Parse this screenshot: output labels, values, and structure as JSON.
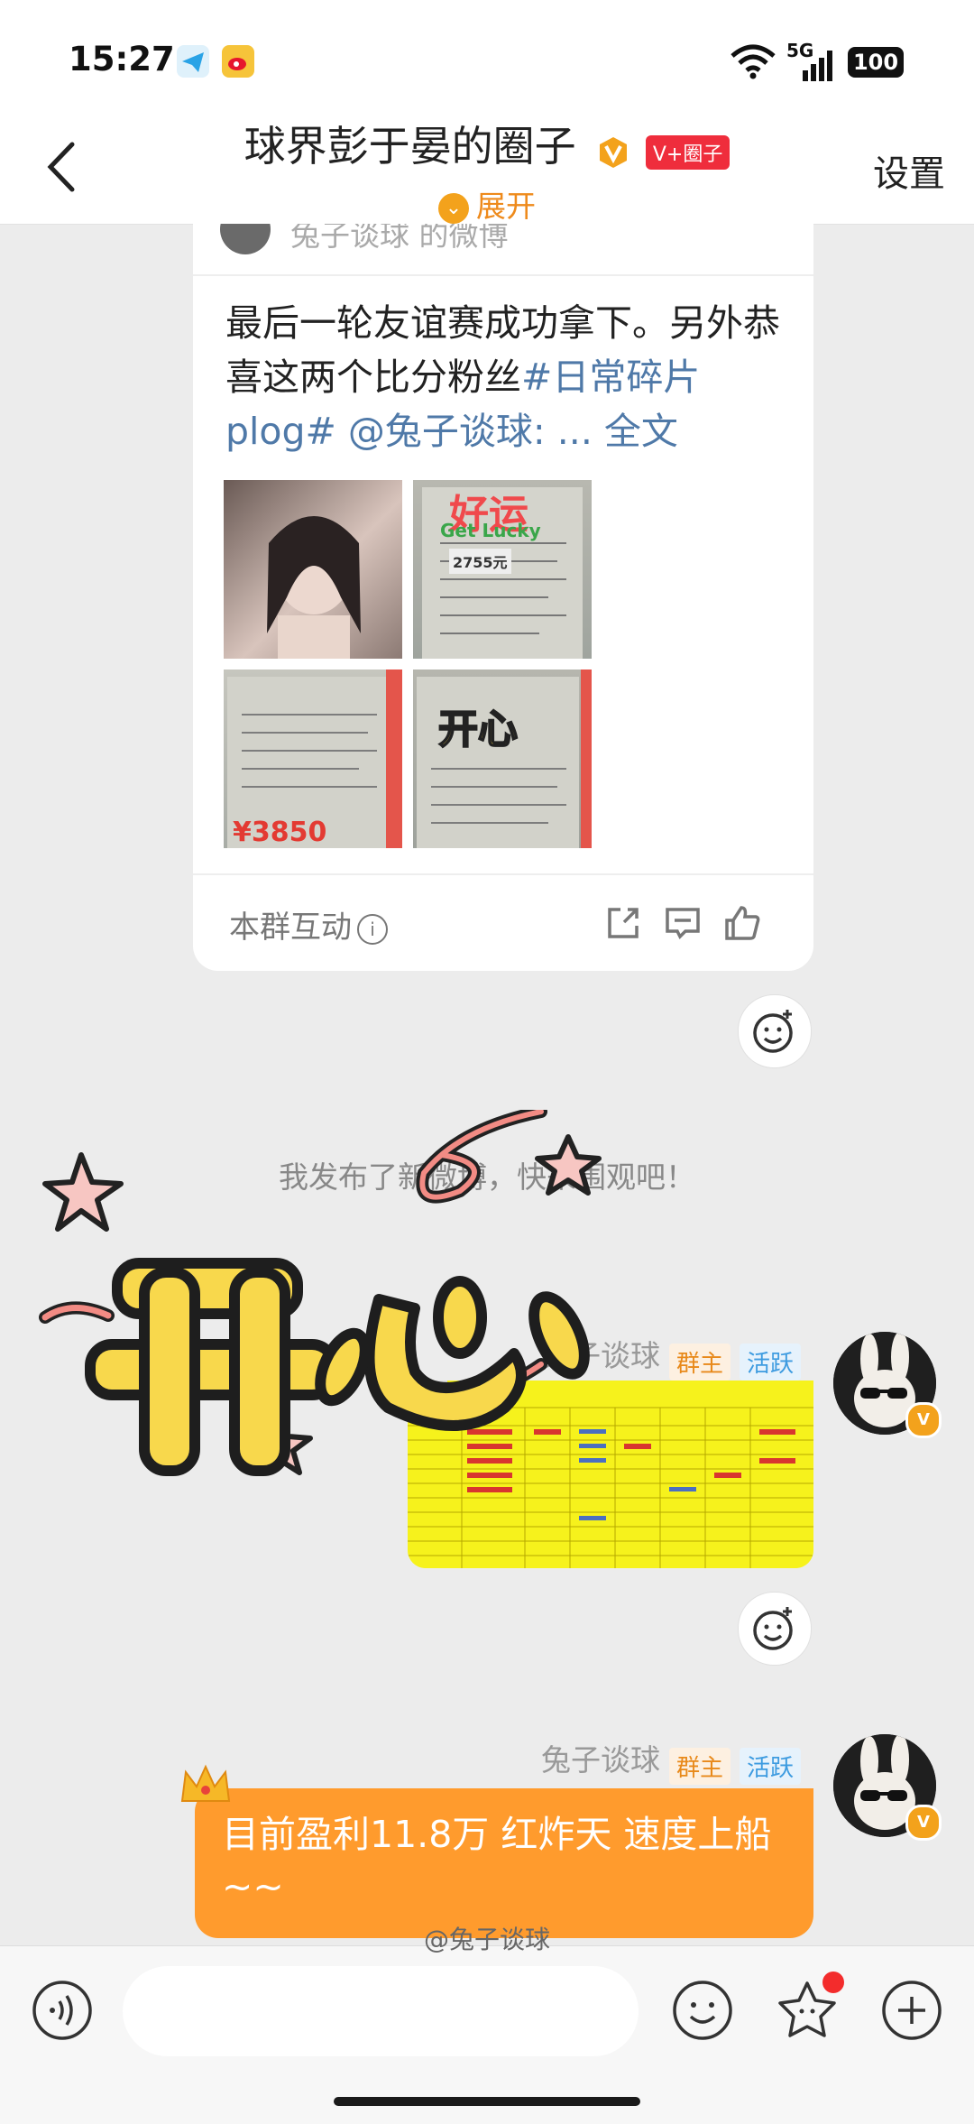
{
  "status_bar": {
    "time": "15:27",
    "network": "5G",
    "battery": "100"
  },
  "header": {
    "back_icon": "chevron-left-icon",
    "title": "球界彭于晏的圈子",
    "badge": "V+圈子",
    "expand_label": "展开",
    "settings_label": "设置"
  },
  "card": {
    "source": "兔子谈球 的微博",
    "text_main": "最后一轮友谊赛成功拿下。另外恭喜这两个比分粉丝",
    "text_hashtag": "#日常碎片plog#",
    "text_mention": " @兔子谈球: ...",
    "text_more": " 全文",
    "image_captions": [
      "好运",
      "Get Lucky",
      "2755元",
      "开心"
    ],
    "interact_label": "本群互动",
    "footer_icons": [
      "share-icon",
      "comment-icon",
      "like-icon"
    ]
  },
  "system_message": "我发布了新微博，快来围观吧！",
  "messages": [
    {
      "sender": "兔子谈球",
      "tags": [
        "群主",
        "活跃"
      ],
      "type": "image"
    },
    {
      "sender": "兔子谈球",
      "tags": [
        "群主",
        "活跃"
      ],
      "type": "text",
      "text": "目前盈利11.8万 红炸天 速度上船~~"
    }
  ],
  "sticker_text": "开心",
  "input_bar": {
    "icons": [
      "voice-icon",
      "emoji-icon",
      "star-sticker-icon",
      "add-icon"
    ],
    "placeholder": ""
  },
  "watermark": "@兔子谈球",
  "colors": {
    "accent_orange": "#ff9b2d",
    "link_blue": "#4f79a8",
    "owner_tag": "#e8891a",
    "active_tag": "#3d9be0",
    "notification": "#f32c2c"
  }
}
